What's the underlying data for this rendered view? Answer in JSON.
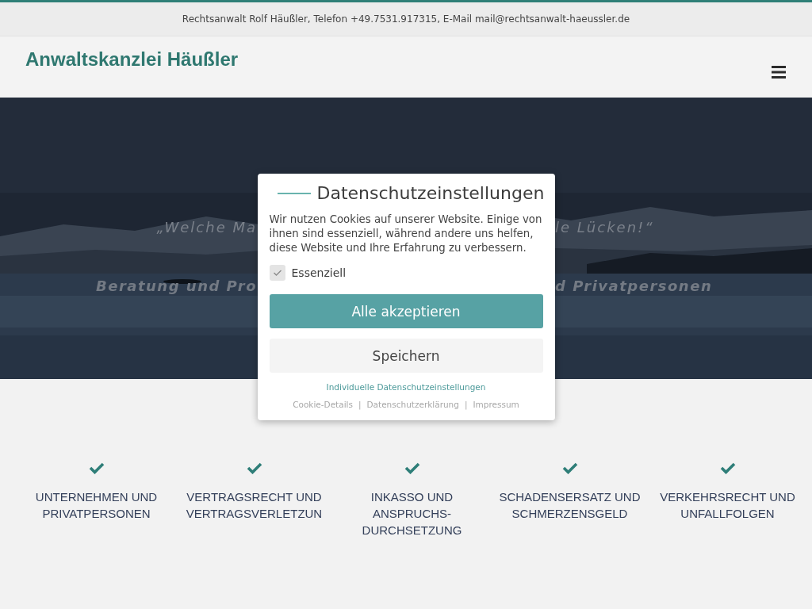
{
  "top_bar": {
    "text": "Rechtsanwalt Rolf Häußler, Telefon +49.7531.917315, E-Mail mail@rechtsanwalt-haeussler.de"
  },
  "header": {
    "logo": "Anwaltskanzlei Häußler"
  },
  "hero": {
    "quote_left": "„Welche Ma",
    "quote_right": "le Lücken!“",
    "subtitle_left": "Beratung und Pro",
    "subtitle_right": "d Privatpersonen"
  },
  "features": [
    {
      "title": "UNTERNEHMEN UND PRIVATPERSONEN"
    },
    {
      "title": "VERTRAGSRECHT UND VERTRAGSVERLETZUN"
    },
    {
      "title": "INKASSO UND ANSPRUCHS-DURCHSETZUNG"
    },
    {
      "title": "SCHADENSERSATZ UND SCHMERZENSGELD"
    },
    {
      "title": "VERKEHRSRECHT UND UNFALLFOLGEN"
    }
  ],
  "cookie_dialog": {
    "title": "Datenschutzeinstellungen",
    "text": "Wir nutzen Cookies auf unserer Website. Einige von ihnen sind essenziell, während andere uns helfen, diese Website und Ihre Erfahrung zu verbessern.",
    "options": [
      {
        "label": "Essenziell",
        "checked": true,
        "disabled": true
      }
    ],
    "accept_button": "Alle akzeptieren",
    "save_button": "Speichern",
    "individual_link": "Individuelle Datenschutzeinstellungen",
    "footer_links": [
      "Cookie-Details",
      "Datenschutzerklärung",
      "Impressum"
    ],
    "link_separator": "|"
  }
}
